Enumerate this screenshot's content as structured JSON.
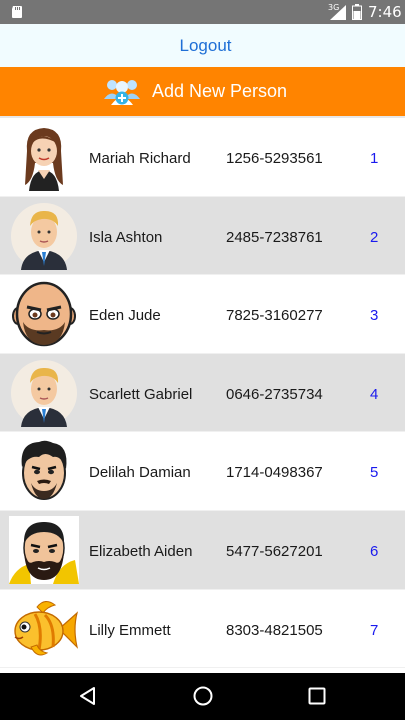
{
  "status_bar": {
    "network": "3G",
    "time": "7:46"
  },
  "header": {
    "logout_label": "Logout"
  },
  "add_bar": {
    "label": "Add New Person",
    "icon": "people-add-icon"
  },
  "people": [
    {
      "name": "Mariah Richard",
      "phone": "1256-5293561",
      "index": "1",
      "avatar": "woman-avatar"
    },
    {
      "name": "Isla Ashton",
      "phone": "2485-7238761",
      "index": "2",
      "avatar": "blond-man-avatar"
    },
    {
      "name": "Eden Jude",
      "phone": "7825-3160277",
      "index": "3",
      "avatar": "bald-man-avatar"
    },
    {
      "name": "Scarlett Gabriel",
      "phone": "0646-2735734",
      "index": "4",
      "avatar": "blond-man-avatar"
    },
    {
      "name": "Delilah Damian",
      "phone": "1714-0498367",
      "index": "5",
      "avatar": "dark-hair-man-avatar"
    },
    {
      "name": "Elizabeth Aiden",
      "phone": "5477-5627201",
      "index": "6",
      "avatar": "bearded-man-avatar"
    },
    {
      "name": "Lilly Emmett",
      "phone": "8303-4821505",
      "index": "7",
      "avatar": "goldfish-avatar"
    }
  ],
  "colors": {
    "accent": "#ff8400",
    "link": "#1f6fd6",
    "index": "#1a1aee",
    "alt_row": "#e0e0e0"
  }
}
